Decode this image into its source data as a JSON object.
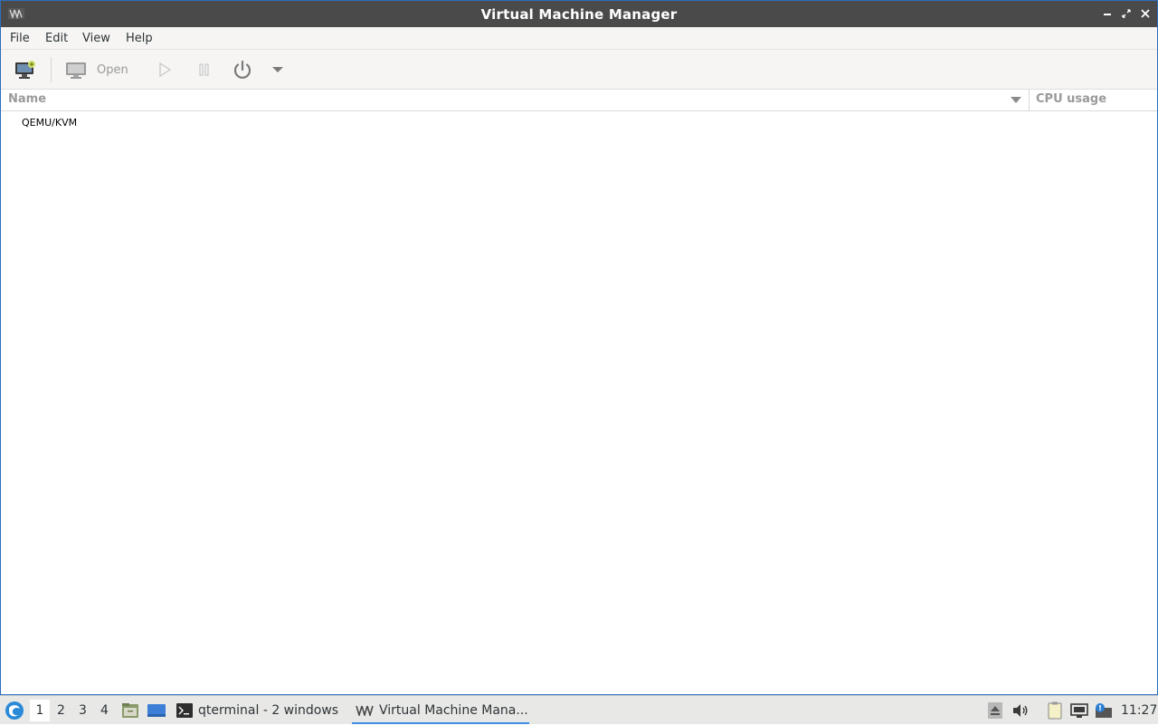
{
  "window": {
    "title": "Virtual Machine Manager"
  },
  "menubar": {
    "items": [
      "File",
      "Edit",
      "View",
      "Help"
    ]
  },
  "toolbar": {
    "open_label": "Open"
  },
  "list": {
    "columns": [
      "Name",
      "CPU usage"
    ],
    "connections": [
      {
        "name": "QEMU/KVM"
      }
    ]
  },
  "taskbar": {
    "workspaces": [
      "1",
      "2",
      "3",
      "4"
    ],
    "active_workspace": "1",
    "tasks": [
      {
        "label": "qterminal - 2 windows",
        "icon": "terminal-icon"
      },
      {
        "label": "Virtual Machine Mana...",
        "icon": "virt-manager-icon",
        "active": true
      }
    ],
    "clock": "11:27"
  },
  "colors": {
    "titlebar_bg": "#4a4a4a",
    "window_border": "#2d6dbd",
    "taskbar_accent": "#3d8ee6",
    "taskbar_bg": "#e8e8e7"
  }
}
